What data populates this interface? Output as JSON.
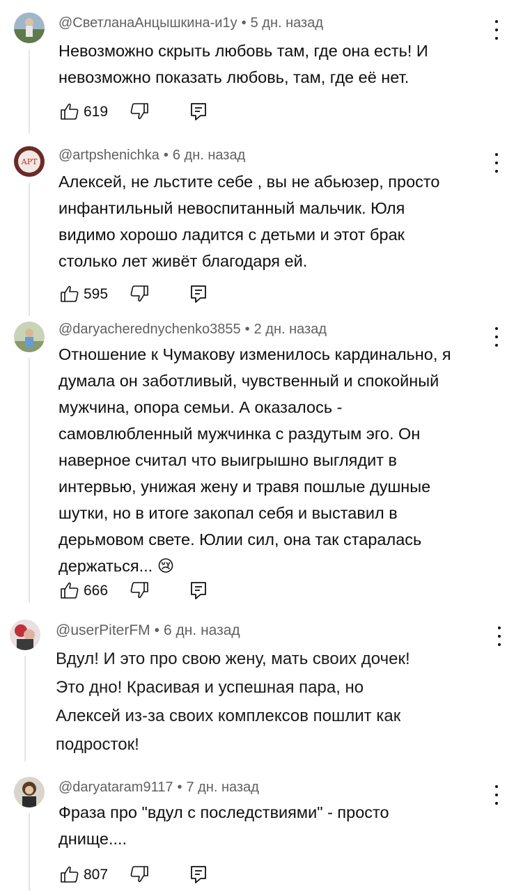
{
  "comments": [
    {
      "author": "@СветланаАнцышкина-и1у",
      "time": "5 дн. назад",
      "text": "Невозможно скрыть любовь там, где она есть! И\nневозможно показать любовь, там, где её нет.",
      "likes": "619"
    },
    {
      "author": "@artpshenichka",
      "time": "6 дн. назад",
      "text": "Алексей, не льстите себе , вы не абьюзер, просто\nинфантильный невоспитанный мальчик. Юля\nвидимо хорошо ладится с детьми и этот брак\nстолько лет живёт благодаря ей.",
      "likes": "595",
      "avatar_text": "АРТ"
    },
    {
      "author": "@daryacherednychenko3855",
      "time": "2 дн. назад",
      "text": "Отношение к Чумакову изменилось кардинально, я\nдумала он заботливый, чувственный и спокойный\nмужчина, опора семьи. А оказалось -\nсамовлюбленный мужчинка с раздутым эго. Он\nнаверное считал что выигрышно выглядит в\nинтервью, унижая жену и травя пошлые душные\nшутки, но в итоге закопал себя и выставил в\nдерьмовом свете. Юлии сил, она так старалась\nдержаться... 😢",
      "likes": "666"
    },
    {
      "author": "@userPiterFM",
      "time": "6 дн. назад",
      "text": "Вдул! И это про свою жену, мать своих дочек!\nЭто дно! Красивая и успешная пара, но\nАлексей из-за своих комплексов пошлит как\nподросток!"
    },
    {
      "author": "@daryataram9117",
      "time": "7 дн. назад",
      "text": "Фраза про \"вдул с последствиями\" - просто\nднище....",
      "likes": "807"
    }
  ],
  "separator": "•",
  "icons": {
    "like": "thumb-up-icon",
    "dislike": "thumb-down-icon",
    "reply": "reply-icon",
    "menu": "more-vert-icon"
  }
}
